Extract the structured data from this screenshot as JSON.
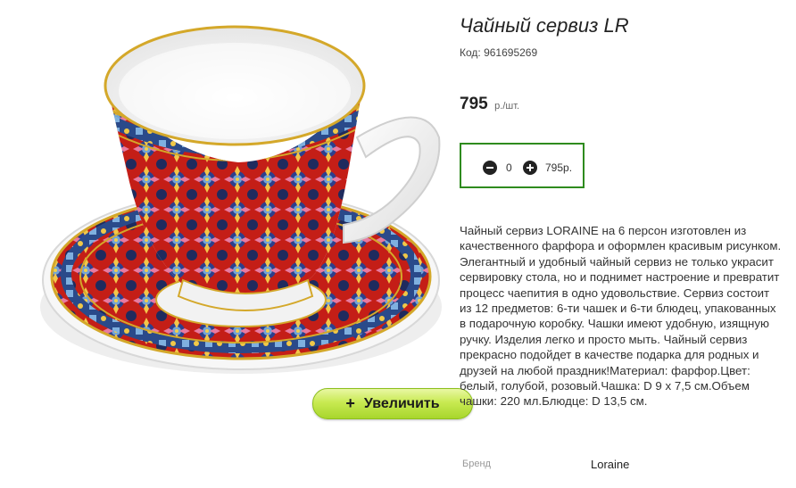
{
  "product": {
    "title": "Чайный сервиз LR",
    "code": "Код: 961695269",
    "price": "795",
    "price_unit": "р./шт.",
    "description": "Чайный сервиз LORAINE на 6 персон изготовлен из качественного фарфора и оформлен красивым рисунком. Элегантный и удобный чайный сервиз не только украсит сервировку стола, но и поднимет настроение и превратит процесс чаепития в одно удовольствие. Сервиз состоит из 12 предметов: 6-ти чашек и 6-ти блюдец, упакованных в подарочную коробку. Чашки имеют удобную, изящную ручку. Изделия легко и просто мыть. Чайный сервиз прекрасно подойдет в качестве подарка для родных и друзей на любой праздник!Материал: фарфор.Цвет: белый, голубой, розовый.Чашка: D 9 х 7,5 см.Объем чашки: 220 мл.Блюдце: D 13,5 см.",
    "brand_label": "Бренд",
    "brand_value": "Loraine"
  },
  "quantity": {
    "value": "0",
    "total": "795р.",
    "minus_icon": "minus-circle-icon",
    "plus_icon": "plus-circle-icon"
  },
  "zoom_button": {
    "plus": "+",
    "label": "Увеличить"
  },
  "colors": {
    "accent_border": "#2e8b1e",
    "button_green": "#b5de3a",
    "cup_red": "#c8201a",
    "cup_gold": "#d4a82a"
  }
}
